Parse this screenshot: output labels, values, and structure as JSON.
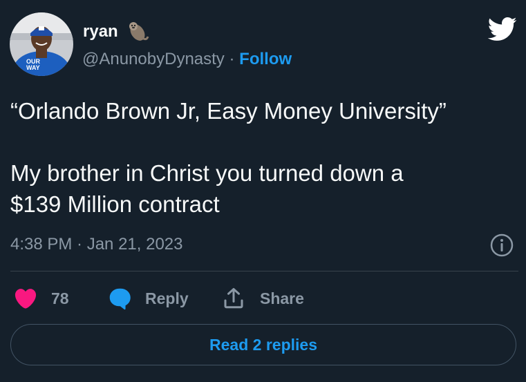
{
  "author": {
    "name": "ryan",
    "name_emoji": "otter-emoji",
    "handle": "@AnunobyDynasty",
    "separator": "·",
    "follow_label": "Follow",
    "avatar_shirt_text": "OUR WAY"
  },
  "brand": {
    "logo_icon": "twitter-bird-icon",
    "accent_color": "#1d9bf0"
  },
  "tweet": {
    "text": "“Orlando Brown Jr, Easy Money University”\n\nMy brother in Christ you turned down a\n$139 Million contract",
    "timestamp": "4:38 PM · Jan 21, 2023",
    "info_icon": "info-icon"
  },
  "actions": {
    "like_count": "78",
    "like_icon": "heart-icon",
    "like_color": "#f91880",
    "reply_label": "Reply",
    "reply_icon": "speech-bubble-icon",
    "share_label": "Share",
    "share_icon": "share-upload-icon"
  },
  "footer": {
    "read_replies_label": "Read 2 replies"
  },
  "colors": {
    "background": "#15202b",
    "primary_text": "#f7f9f9",
    "secondary_text": "#8b98a5",
    "divider": "#38444d"
  }
}
